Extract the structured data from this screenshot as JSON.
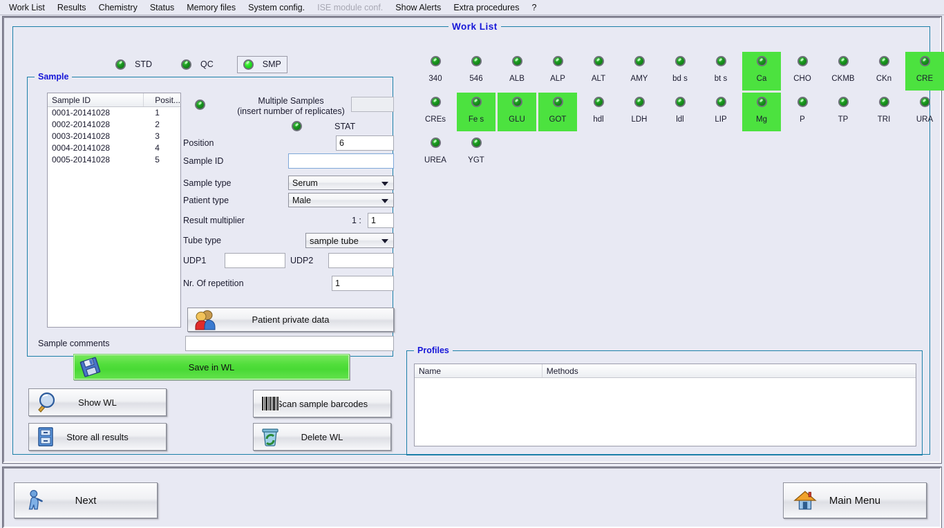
{
  "menu": {
    "items": [
      {
        "label": "Work List",
        "disabled": false
      },
      {
        "label": "Results",
        "disabled": false
      },
      {
        "label": "Chemistry",
        "disabled": false
      },
      {
        "label": "Status",
        "disabled": false
      },
      {
        "label": "Memory files",
        "disabled": false
      },
      {
        "label": "System config.",
        "disabled": false
      },
      {
        "label": "ISE module conf.",
        "disabled": true
      },
      {
        "label": "Show Alerts",
        "disabled": false
      },
      {
        "label": "Extra procedures",
        "disabled": false
      },
      {
        "label": "?",
        "disabled": false
      }
    ]
  },
  "worklist": {
    "title": "Work List",
    "modes": [
      {
        "label": "STD",
        "selected": false,
        "active": false
      },
      {
        "label": "QC",
        "selected": false,
        "active": false
      },
      {
        "label": "SMP",
        "selected": true,
        "active": true
      }
    ]
  },
  "sample": {
    "legend": "Sample",
    "list": {
      "columns": [
        "Sample ID",
        "Posit..."
      ],
      "rows": [
        [
          "0001-20141028",
          "1"
        ],
        [
          "0002-20141028",
          "2"
        ],
        [
          "0003-20141028",
          "3"
        ],
        [
          "0004-20141028",
          "4"
        ],
        [
          "0005-20141028",
          "5"
        ]
      ]
    },
    "multiple_samples_line1": "Multiple Samples",
    "multiple_samples_line2": "(insert number of replicates)",
    "replicates_value": "",
    "stat_label": "STAT",
    "fields": {
      "position_label": "Position",
      "position_value": "6",
      "sample_id_label": "Sample ID",
      "sample_id_value": "",
      "sample_type_label": "Sample type",
      "sample_type_value": "Serum",
      "patient_type_label": "Patient type",
      "patient_type_value": "Male",
      "result_multiplier_label": "Result multiplier",
      "result_multiplier_prefix": "1 :",
      "result_multiplier_value": "1",
      "tube_type_label": "Tube type",
      "tube_type_value": "sample tube",
      "udp1_label": "UDP1",
      "udp1_value": "",
      "udp2_label": "UDP2",
      "udp2_value": "",
      "repetition_label": "Nr. Of repetition",
      "repetition_value": "1",
      "comments_label": "Sample comments",
      "comments_value": ""
    },
    "patient_private_data_button": "Patient private data"
  },
  "tests": {
    "row1": [
      {
        "label": "340",
        "selected": false
      },
      {
        "label": "546",
        "selected": false
      },
      {
        "label": "ALB",
        "selected": false
      },
      {
        "label": "ALP",
        "selected": false
      },
      {
        "label": "ALT",
        "selected": false
      },
      {
        "label": "AMY",
        "selected": false
      },
      {
        "label": "bd s",
        "selected": false
      },
      {
        "label": "bt s",
        "selected": false
      },
      {
        "label": "Ca",
        "selected": true
      },
      {
        "label": "CHO",
        "selected": false
      },
      {
        "label": "CKMB",
        "selected": false
      },
      {
        "label": "CKn",
        "selected": false
      },
      {
        "label": "CRE",
        "selected": true
      }
    ],
    "row2": [
      {
        "label": "CREs",
        "selected": false
      },
      {
        "label": "Fe s",
        "selected": true
      },
      {
        "label": "GLU",
        "selected": true
      },
      {
        "label": "GOT",
        "selected": true
      },
      {
        "label": "hdl",
        "selected": false
      },
      {
        "label": "LDH",
        "selected": false
      },
      {
        "label": "ldl",
        "selected": false
      },
      {
        "label": "LIP",
        "selected": false
      },
      {
        "label": "Mg",
        "selected": true
      },
      {
        "label": "P",
        "selected": false
      },
      {
        "label": "TP",
        "selected": false
      },
      {
        "label": "TRI",
        "selected": false
      },
      {
        "label": "URA",
        "selected": false
      }
    ],
    "row3": [
      {
        "label": "UREA",
        "selected": false
      },
      {
        "label": "YGT",
        "selected": false
      }
    ]
  },
  "actions": {
    "save_in_wl": "Save in WL",
    "show_wl": "Show WL",
    "store_all_results": "Store all results",
    "scan_sample_barcodes": "Scan sample barcodes",
    "delete_wl": "Delete WL"
  },
  "profiles": {
    "legend": "Profiles",
    "columns": [
      "Name",
      "Methods"
    ],
    "rows": []
  },
  "navigation": {
    "next": "Next",
    "main_menu": "Main Menu"
  },
  "colors": {
    "accent_blue": "#1616d8",
    "group_border": "#1b7fa8",
    "selected_green": "#4ce23f",
    "window_bg": "#e8e9f3"
  }
}
